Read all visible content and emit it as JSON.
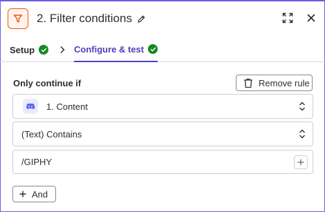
{
  "header": {
    "title": "2. Filter conditions",
    "icons": [
      "filter-icon",
      "pencil-icon",
      "expand-icon",
      "close-icon"
    ],
    "accent": "#ff4f00"
  },
  "tabs": [
    {
      "label": "Setup",
      "status": "complete"
    },
    {
      "label": "Configure & test",
      "status": "complete",
      "active": true
    }
  ],
  "colors": {
    "active_tab": "#503ebd",
    "check": "#138a1f",
    "border": "#695be8"
  },
  "rule": {
    "heading": "Only continue if",
    "remove_label": "Remove rule",
    "field": {
      "value": "1. Content",
      "icon": "discord-icon"
    },
    "operator": {
      "value": "(Text) Contains"
    },
    "value": {
      "value": "/GIPHY"
    },
    "and_label": "And"
  }
}
